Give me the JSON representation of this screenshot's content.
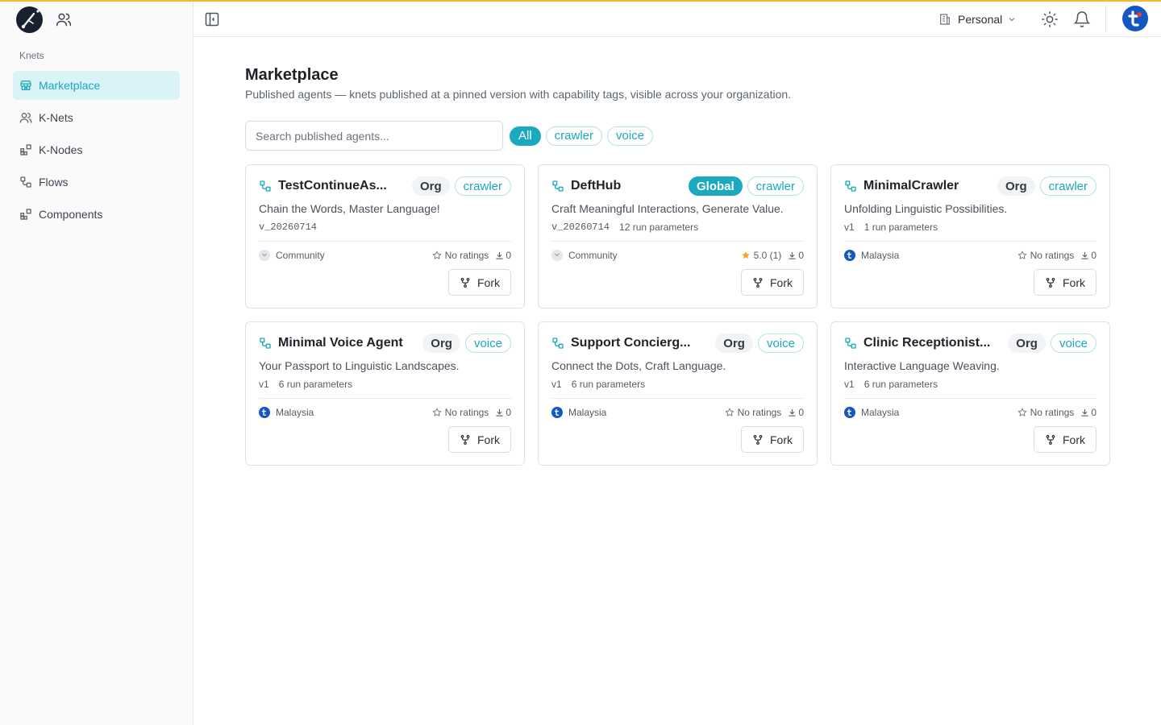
{
  "colors": {
    "accent": "#1aa9be",
    "accent_soft": "#d9f3f6",
    "top_line": "#f5b82e",
    "star": "#f5a623",
    "avatar": "#1457c0"
  },
  "sidebar": {
    "section_label": "Knets",
    "items": [
      {
        "label": "Marketplace",
        "icon": "store-icon",
        "active": true
      },
      {
        "label": "K-Nets",
        "icon": "users-icon",
        "active": false
      },
      {
        "label": "K-Nodes",
        "icon": "blocks-icon",
        "active": false
      },
      {
        "label": "Flows",
        "icon": "flow-icon",
        "active": false
      },
      {
        "label": "Components",
        "icon": "blocks-icon",
        "active": false
      }
    ]
  },
  "topbar": {
    "workspace": "Personal"
  },
  "page": {
    "title": "Marketplace",
    "subtitle": "Published agents — knets published at a pinned version with capability tags, visible across your organization.",
    "search_placeholder": "Search published agents...",
    "filters": [
      "All",
      "crawler",
      "voice"
    ]
  },
  "cards": [
    {
      "name": "TestContinueAs...",
      "scope": "Org",
      "tag": "crawler",
      "description": "Chain the Words, Master Language!",
      "version": "v_20260714",
      "params": "",
      "publisher": "Community",
      "rating": "No ratings",
      "downloads": "0",
      "fork_label": "Fork"
    },
    {
      "name": "DeftHub",
      "scope": "Global",
      "tag": "crawler",
      "description": "Craft Meaningful Interactions, Generate Value.",
      "version": "v_20260714",
      "params": "12 run parameters",
      "publisher": "Community",
      "rating": "5.0 (1)",
      "downloads": "0",
      "fork_label": "Fork"
    },
    {
      "name": "MinimalCrawler",
      "scope": "Org",
      "tag": "crawler",
      "description": "Unfolding Linguistic Possibilities.",
      "version": "v1",
      "params": "1 run parameters",
      "publisher": "Malaysia",
      "rating": "No ratings",
      "downloads": "0",
      "fork_label": "Fork"
    },
    {
      "name": "Minimal Voice Agent",
      "scope": "Org",
      "tag": "voice",
      "description": "Your Passport to Linguistic Landscapes.",
      "version": "v1",
      "params": "6 run parameters",
      "publisher": "Malaysia",
      "rating": "No ratings",
      "downloads": "0",
      "fork_label": "Fork"
    },
    {
      "name": "Support Concierg...",
      "scope": "Org",
      "tag": "voice",
      "description": "Connect the Dots, Craft Language.",
      "version": "v1",
      "params": "6 run parameters",
      "publisher": "Malaysia",
      "rating": "No ratings",
      "downloads": "0",
      "fork_label": "Fork"
    },
    {
      "name": "Clinic Receptionist...",
      "scope": "Org",
      "tag": "voice",
      "description": "Interactive Language Weaving.",
      "version": "v1",
      "params": "6 run parameters",
      "publisher": "Malaysia",
      "rating": "No ratings",
      "downloads": "0",
      "fork_label": "Fork"
    }
  ]
}
